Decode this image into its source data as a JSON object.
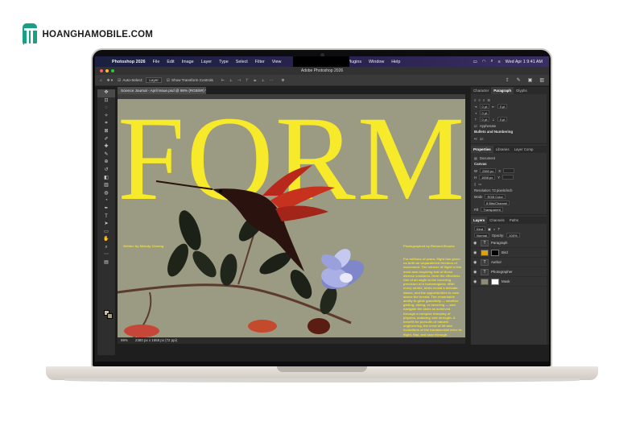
{
  "watermark": {
    "text": "HOANGHAMOBILE.COM",
    "brand_color": "#1a9e86"
  },
  "menubar": {
    "items": [
      "Photoshop 2026",
      "File",
      "Edit",
      "Image",
      "Layer",
      "Type",
      "Select",
      "Filter",
      "View",
      "Plugins",
      "Window",
      "Help"
    ],
    "clock": "Wed Apr 1  9:41 AM",
    "background": "#1b2040"
  },
  "window": {
    "title": "Adobe Photoshop 2026"
  },
  "options_bar": {
    "auto_select_label": "Auto-Select:",
    "auto_select_value": "Layer",
    "transform_label": "Show Transform Controls"
  },
  "tools": [
    "move-icon",
    "artboard-icon",
    "lasso-icon",
    "magic-wand-icon",
    "crop-icon",
    "frame-icon",
    "eyedropper-icon",
    "healing-icon",
    "brush-icon",
    "stamp-icon",
    "history-brush-icon",
    "eraser-icon",
    "gradient-icon",
    "blur-icon",
    "dodge-icon",
    "pen-icon",
    "type-icon",
    "path-select-icon",
    "rectangle-icon",
    "hand-icon",
    "zoom-icon",
    "more-icon",
    "edit-toolbar-icon"
  ],
  "document": {
    "tab_title": "Science Journal - April Issue.psd @ 98% (RGB/8#) *",
    "headline": "FORM",
    "written_by": "Written by Melody Cheong",
    "photo_by": "Photographed by Richard Brooks",
    "body": "For millions of years, flight has given us birth an unparalleled freedom of movement. The miracle of flight in the most awe-inspiring feat of these diverse creatures, from the effortless rise of an eagle to the hovering precision of a hummingbird. With every stroke, birds reveal a delicate dance, and the opportunities to soar above the terrain. The remarkable ability to glide gracefully — whether gliding, diving, or hovering — and navigate the skies as achieved through a complex interplay of physics, anatomy, and strength. A benefit for pursuits of natural engineering, the crest of lift and evolutions of the fundamental drive to flight, flap, and soar through.",
    "accent_color": "#f6ea2b"
  },
  "status": {
    "zoom": "98%",
    "dimensions": "2380 px x 1658 px (72 ppi)"
  },
  "panels": {
    "top_tabs": [
      "Character",
      "Paragraph",
      "Glyphs"
    ],
    "paragraph_fields": [
      "0 pt",
      "0 pt",
      "0 pt",
      "0 pt",
      "0 pt"
    ],
    "hyphenate": "Hyphenate",
    "bullets": "Bullets and Numbering",
    "props_tabs": [
      "Properties",
      "Libraries",
      "Layer Comp"
    ],
    "document_label": "Document",
    "canvas_label": "Canvas",
    "width_label": "W",
    "width": "2380 px",
    "height_label": "H",
    "height": "1658 px",
    "x_label": "X",
    "y_label": "Y",
    "resolution": "Resolution: 72 pixels/inch",
    "mode_label": "Mode",
    "mode": "RGB Color",
    "bits": "8 Bits/Channel",
    "fill_label": "Fill",
    "fill": "Transparent",
    "layers_tabs": [
      "Layers",
      "Channels",
      "Paths"
    ],
    "kind": "Kind",
    "blend": "Normal",
    "opacity_label": "Opacity:",
    "opacity": "100%",
    "layers": [
      "Paragraph",
      "Bird",
      "Author",
      "Photographer",
      "Mask"
    ]
  }
}
